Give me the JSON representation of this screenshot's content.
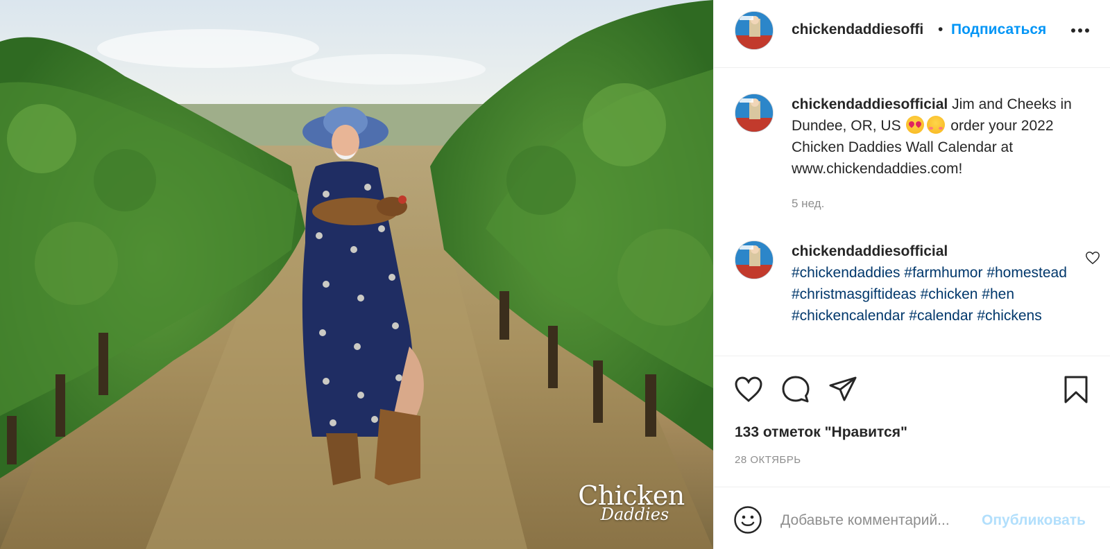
{
  "photo": {
    "alt": "",
    "watermark_line1": "Chicken",
    "watermark_line2": "Daddies"
  },
  "header": {
    "username": "chickendaddiesoffi",
    "separator": "•",
    "follow_label": "Подписаться",
    "more_icon": "more-horizontal-icon"
  },
  "caption": {
    "username": "chickendaddiesofficial",
    "text_part1": "Jim and Cheeks in Dundee, OR, US",
    "emojis": [
      "smiling-face-with-hearts",
      "heart-eyes"
    ],
    "text_part2": "order your 2022 Chicken Daddies Wall Calendar at www.chickendaddies.com!",
    "time": "5 нед."
  },
  "comment": {
    "username": "chickendaddiesofficial",
    "hashtags": "#chickendaddies #farmhumor #homestead #christmasgiftideas #chicken #hen #chickencalendar #calendar #chickens",
    "heart_icon": "heart-outline-icon"
  },
  "actions": {
    "like_icon": "heart-icon",
    "comment_icon": "comment-icon",
    "share_icon": "share-icon",
    "save_icon": "bookmark-icon"
  },
  "likes_text": "133 отметок \"Нравится\"",
  "date_text": "28 ОКТЯБРЬ",
  "composer": {
    "emoji_icon": "smile-icon",
    "placeholder": "Добавьте комментарий...",
    "value": "",
    "publish_label": "Опубликовать"
  },
  "colors": {
    "accent": "#0095f6",
    "hashtag": "#00376b",
    "muted": "#8e8e8e",
    "publish_disabled": "#b2dffc"
  }
}
